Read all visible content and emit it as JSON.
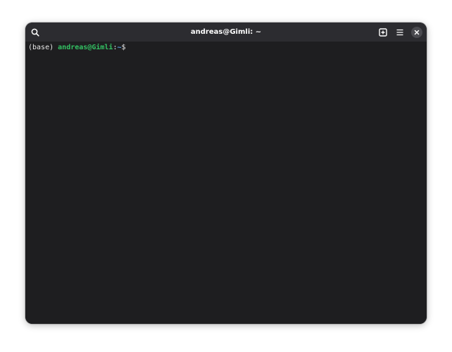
{
  "window": {
    "title": "andreas@Gimli: ~"
  },
  "headerbar": {
    "icons": {
      "search": "search-icon",
      "new_tab": "new-tab-icon",
      "menu": "hamburger-menu-icon",
      "close": "close-icon"
    }
  },
  "terminal": {
    "env": "(base)",
    "user_host": "andreas@Gimli",
    "separator": ":",
    "path": "~",
    "prompt_symbol": "$"
  },
  "colors": {
    "background": "#1e1e20",
    "headerbar": "#2c2c30",
    "user_host": "#33c263",
    "path": "#5aa0e0",
    "text": "#e8e8e8"
  }
}
